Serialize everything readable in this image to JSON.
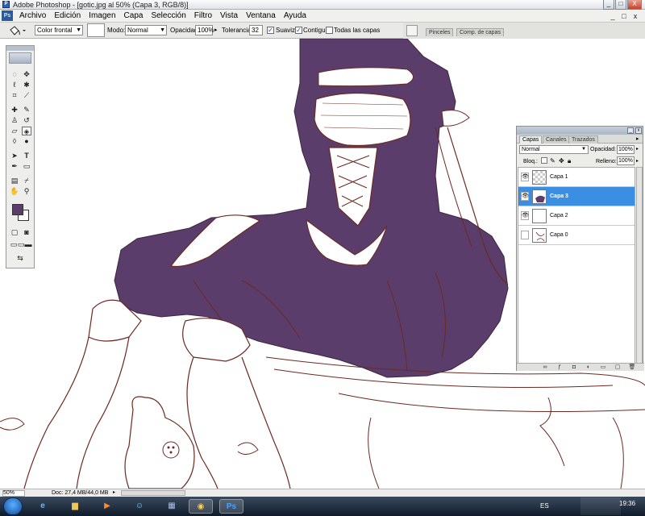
{
  "window": {
    "title": "Adobe Photoshop - [gotic.jpg al 50% (Capa 3, RGB/8)]",
    "minimize_label": "_",
    "maximize_label": "□",
    "close_label": "X"
  },
  "menubar": {
    "logo_text": "Ps",
    "items": [
      "Archivo",
      "Edición",
      "Imagen",
      "Capa",
      "Selección",
      "Filtro",
      "Vista",
      "Ventana",
      "Ayuda"
    ],
    "doc_minimize": "_",
    "doc_restore": "□",
    "doc_close": "x"
  },
  "options": {
    "fill_source": "Color frontal",
    "mode_label": "Modo:",
    "mode_value": "Normal",
    "opacity_label": "Opacidad:",
    "opacity_value": "100%",
    "tolerance_label": "Tolerancia:",
    "tolerance_value": "32",
    "antialias_label": "Suavizar",
    "antialias_checked": true,
    "contiguous_label": "Contiguo",
    "contiguous_checked": true,
    "all_layers_label": "Todas las capas",
    "all_layers_checked": false,
    "check_mark": "✓"
  },
  "palette_well": {
    "tabs": [
      "Pinceles",
      "Comp. de capas"
    ]
  },
  "tools": {
    "foreground_color": "#5a3d6a",
    "background_color": "#ffffff",
    "active_tool": "paint-bucket"
  },
  "layers_panel": {
    "tabs": [
      "Capas",
      "Canales",
      "Trazados"
    ],
    "active_tab": "Capas",
    "blend_mode": "Normal",
    "opacity_label": "Opacidad:",
    "opacity_value": "100%",
    "lock_label": "Bloq.:",
    "fill_label": "Relleno:",
    "fill_value": "100%",
    "layers": [
      {
        "name": "Capa 1",
        "visible": true,
        "selected": false
      },
      {
        "name": "Capa 3",
        "visible": true,
        "selected": true
      },
      {
        "name": "Capa 2",
        "visible": true,
        "selected": false
      },
      {
        "name": "Capa 0",
        "visible": false,
        "selected": false
      }
    ]
  },
  "statusbar": {
    "zoom": "50%",
    "doc_info": "Doc: 27,4 MB/44,0 MB"
  },
  "taskbar": {
    "language": "ES",
    "time": "19:36"
  },
  "colors": {
    "dress_fill": "#5a3d6a",
    "line_art": "#6b2a22",
    "selection_blue": "#3a8fe3"
  }
}
